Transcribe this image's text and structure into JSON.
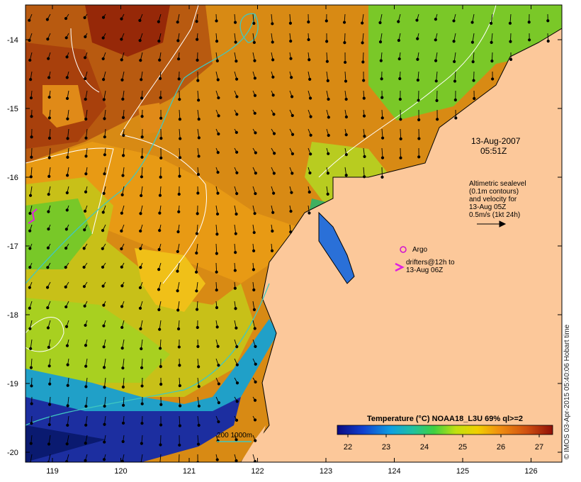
{
  "map": {
    "date": "13-Aug-2007",
    "time": "05:51Z",
    "credit": "© IMOS 03-Apr-2015 05:40:06 Hobart time",
    "lat_ticks": [
      "-14",
      "-15",
      "-16",
      "-17",
      "-18",
      "-19",
      "-20"
    ],
    "lon_ticks": [
      "119",
      "120",
      "121",
      "122",
      "123",
      "124",
      "125",
      "126"
    ],
    "info_lines": [
      "Altimetric sealevel",
      "(0.1m contours)",
      "and velocity for",
      "13-Aug 05Z",
      "0.5m/s (1kt 24h)"
    ],
    "argo_label": "Argo",
    "drifters_lines": [
      "drifters@12h to",
      "13-Aug 06Z"
    ],
    "depth_label": "200  1000m"
  },
  "colorbar": {
    "title": "Temperature (°C) NOAA18_L3U 69% ql>=2",
    "ticks": [
      "22",
      "23",
      "24",
      "25",
      "26",
      "27"
    ]
  },
  "colors": {
    "land": "#fcc89a",
    "warm": "#c86a10",
    "hot": "#9a2a08",
    "mild": "#e89a10",
    "green": "#9ad020",
    "cool": "#22a8d8",
    "cold": "#102a9a",
    "contour": "#ffffff",
    "isobath": "#40c8c0",
    "argo": "#d010d0"
  }
}
